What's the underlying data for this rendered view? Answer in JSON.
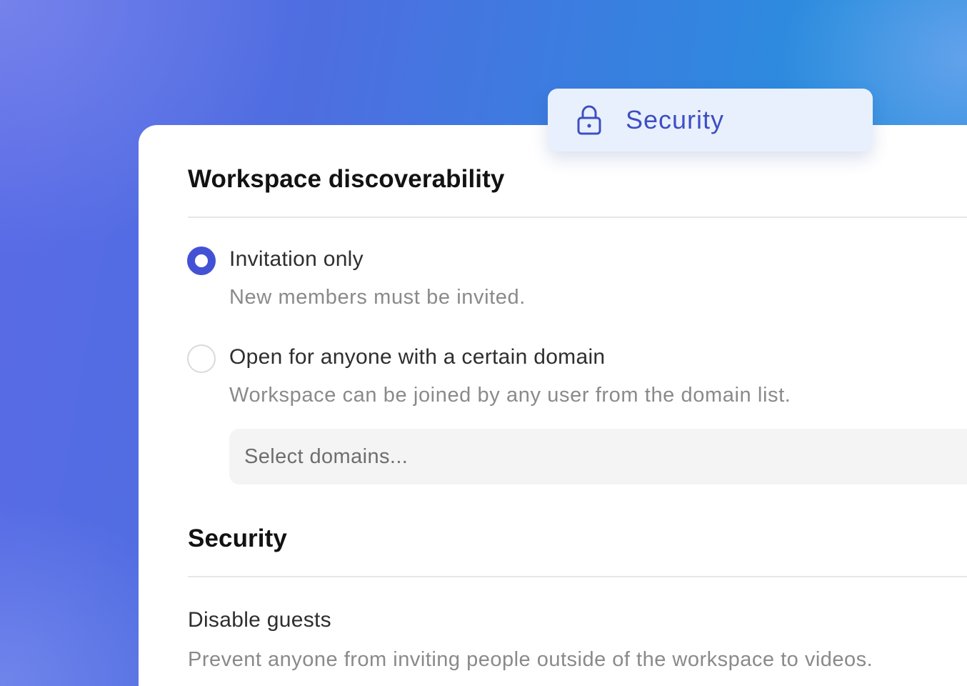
{
  "tab": {
    "label": "Security",
    "icon": "lock-icon"
  },
  "discoverability": {
    "heading": "Workspace discoverability",
    "options": [
      {
        "title": "Invitation only",
        "description": "New members must be invited.",
        "selected": true
      },
      {
        "title": "Open for anyone with a certain domain",
        "description": "Workspace can be joined by any user from the domain list.",
        "selected": false
      }
    ],
    "domain_select": {
      "placeholder": "Select domains..."
    }
  },
  "security": {
    "heading": "Security",
    "settings": [
      {
        "title": "Disable guests",
        "description": "Prevent anyone from inviting people outside of the workspace to videos."
      }
    ]
  },
  "colors": {
    "accent": "#4352d4",
    "tab_background": "#e9f0fd",
    "tab_text": "#3d4fc4"
  }
}
